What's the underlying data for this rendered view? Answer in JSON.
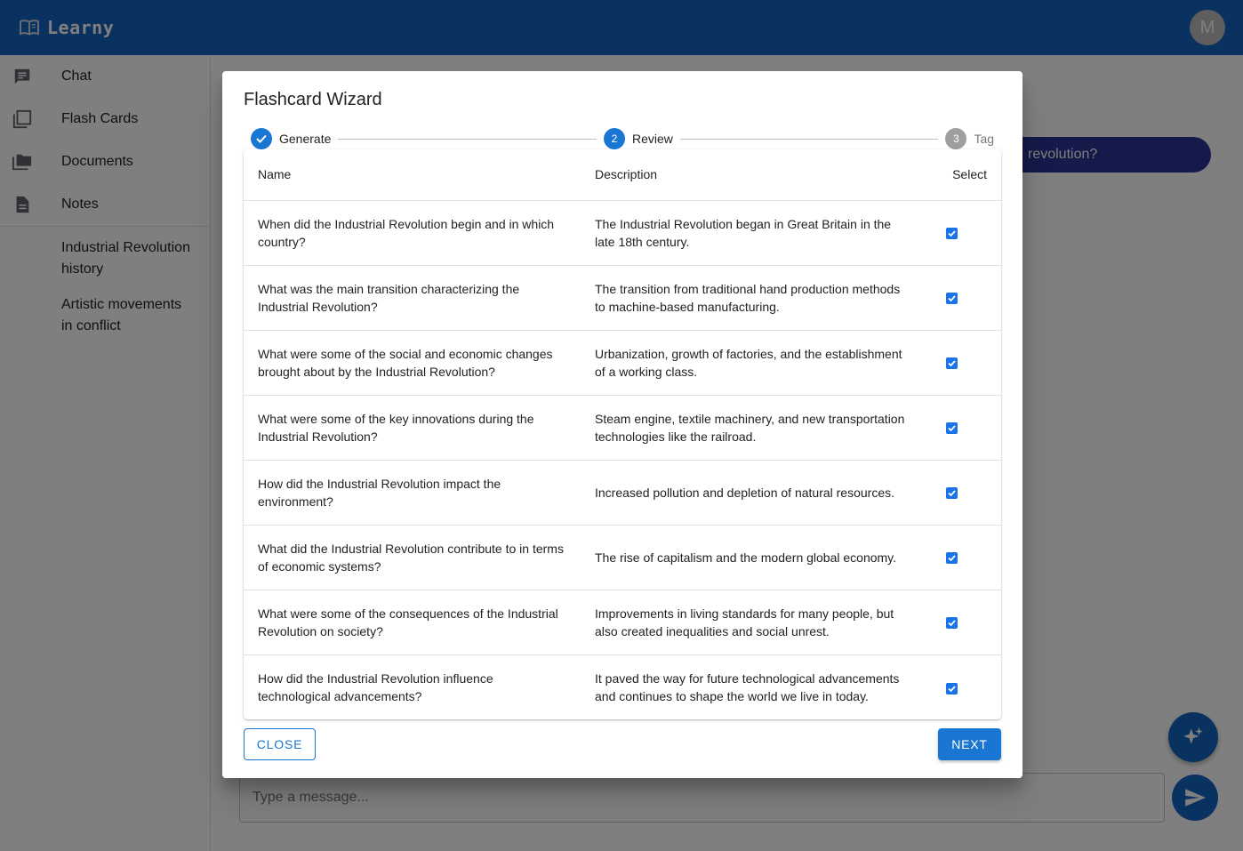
{
  "app": {
    "name": "Learny",
    "avatar_initial": "M",
    "brand_color": "#1565c0"
  },
  "sidebar": {
    "nav": [
      {
        "label": "Chat",
        "icon": "chat-icon"
      },
      {
        "label": "Flash Cards",
        "icon": "flashcards-icon"
      },
      {
        "label": "Documents",
        "icon": "folder-icon"
      },
      {
        "label": "Notes",
        "icon": "document-icon"
      }
    ],
    "notes": [
      {
        "label": "Industrial Revolution history"
      },
      {
        "label": "Artistic movements in conflict"
      }
    ]
  },
  "chat": {
    "bubble_text": "revolution?",
    "input_placeholder": "Type a message..."
  },
  "dialog": {
    "title": "Flashcard Wizard",
    "steps": [
      {
        "label": "Generate",
        "state": "done",
        "number": "1"
      },
      {
        "label": "Review",
        "state": "active",
        "number": "2"
      },
      {
        "label": "Tag",
        "state": "pending",
        "number": "3"
      }
    ],
    "columns": {
      "name": "Name",
      "description": "Description",
      "select": "Select"
    },
    "rows": [
      {
        "name": "When did the Industrial Revolution begin and in which country?",
        "description": "The Industrial Revolution began in Great Britain in the late 18th century.",
        "selected": true
      },
      {
        "name": "What was the main transition characterizing the Industrial Revolution?",
        "description": "The transition from traditional hand production methods to machine-based manufacturing.",
        "selected": true
      },
      {
        "name": "What were some of the social and economic changes brought about by the Industrial Revolution?",
        "description": "Urbanization, growth of factories, and the establishment of a working class.",
        "selected": true
      },
      {
        "name": "What were some of the key innovations during the Industrial Revolution?",
        "description": "Steam engine, textile machinery, and new transportation technologies like the railroad.",
        "selected": true
      },
      {
        "name": "How did the Industrial Revolution impact the environment?",
        "description": "Increased pollution and depletion of natural resources.",
        "selected": true
      },
      {
        "name": "What did the Industrial Revolution contribute to in terms of economic systems?",
        "description": "The rise of capitalism and the modern global economy.",
        "selected": true
      },
      {
        "name": "What were some of the consequences of the Industrial Revolution on society?",
        "description": "Improvements in living standards for many people, but also created inequalities and social unrest.",
        "selected": true
      },
      {
        "name": "How did the Industrial Revolution influence technological advancements?",
        "description": "It paved the way for future technological advancements and continues to shape the world we live in today.",
        "selected": true
      }
    ],
    "close_label": "CLOSE",
    "next_label": "NEXT"
  }
}
